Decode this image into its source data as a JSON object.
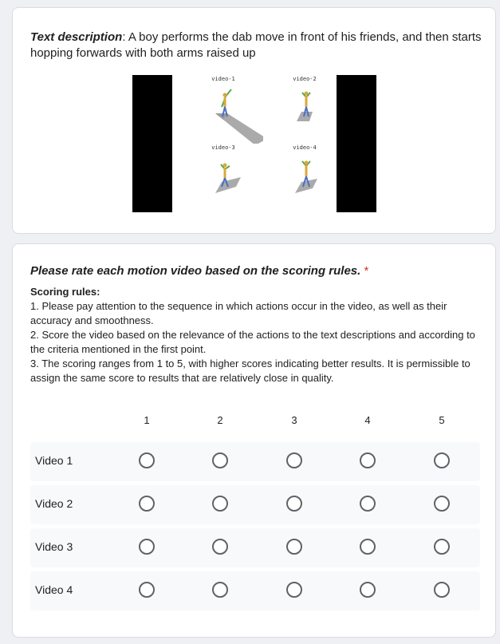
{
  "description": {
    "lead": "Text description",
    "text": ": A boy performs the dab move in front of his friends, and then starts hopping forwards with both arms raised up"
  },
  "videos": {
    "labels": [
      "video-1",
      "video-2",
      "video-3",
      "video-4"
    ]
  },
  "question": {
    "title": "Please rate each motion video based on the scoring rules.",
    "required_mark": "*",
    "rules_heading": "Scoring rules:",
    "rules": [
      "1. Please pay attention to the sequence in which actions occur in the video, as well as their accuracy and smoothness.",
      "2. Score the video based on the relevance of the actions to the text descriptions and according to the criteria mentioned in the first point.",
      "3. The scoring ranges from 1 to 5, with higher scores indicating better results. It is permissible to assign the same score to results that are relatively close in quality."
    ]
  },
  "grid": {
    "columns": [
      "1",
      "2",
      "3",
      "4",
      "5"
    ],
    "rows": [
      "Video 1",
      "Video 2",
      "Video 3",
      "Video 4"
    ]
  },
  "colors": {
    "required": "#d93025",
    "radio_border": "#5f6368",
    "row_bg": "#f8f9fa"
  }
}
